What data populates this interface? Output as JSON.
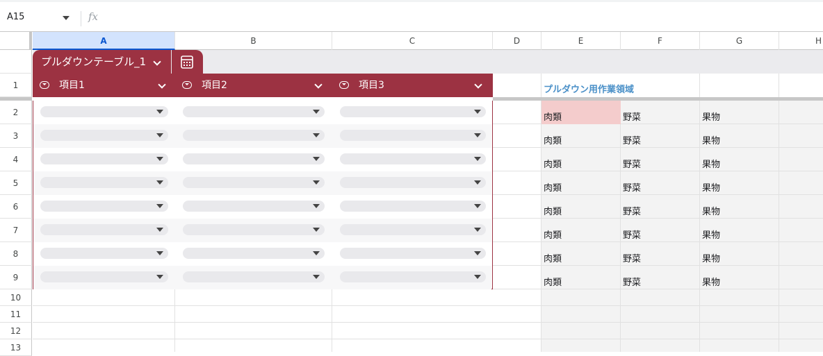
{
  "formula_bar": {
    "name_box": "A15",
    "fx_label": "fx",
    "formula": ""
  },
  "columns": [
    "A",
    "B",
    "C",
    "D",
    "E",
    "F",
    "G",
    "H"
  ],
  "rows": [
    "1",
    "2",
    "3",
    "4",
    "5",
    "6",
    "7",
    "8",
    "9",
    "10",
    "11",
    "12",
    "13"
  ],
  "table": {
    "name": "プルダウンテーブル_1",
    "headers": [
      "項目1",
      "項目2",
      "項目3"
    ],
    "row_count": 8,
    "accent_color": "#9c3242"
  },
  "work_area": {
    "title": "プルダウン用作業領域",
    "title_color": "#4a90c8",
    "rows": [
      [
        "肉類",
        "野菜",
        "果物"
      ],
      [
        "肉類",
        "野菜",
        "果物"
      ],
      [
        "肉類",
        "野菜",
        "果物"
      ],
      [
        "肉類",
        "野菜",
        "果物"
      ],
      [
        "肉類",
        "野菜",
        "果物"
      ],
      [
        "肉類",
        "野菜",
        "果物"
      ],
      [
        "肉類",
        "野菜",
        "果物"
      ],
      [
        "肉類",
        "野菜",
        "果物"
      ]
    ],
    "highlight_color": "#f4cccc"
  },
  "icons": {
    "name_box_dropdown": "caret-down-icon",
    "table_menu": "chevron-down-icon",
    "calculator": "calculator-icon",
    "column_type": "dropdown-chip-icon",
    "chip_dropdown": "caret-down-icon"
  }
}
